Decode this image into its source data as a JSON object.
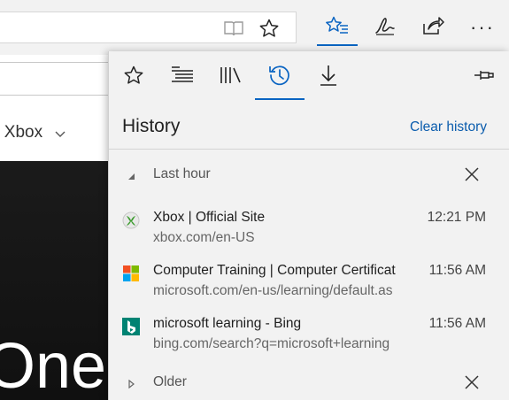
{
  "colors": {
    "accent": "#0a64c2",
    "link": "#0a5cad",
    "panel_bg": "#f2f2f2"
  },
  "toolbar": {
    "icons": [
      "reading-view-icon",
      "favorite-star-icon",
      "hub-favorites-icon",
      "web-note-icon",
      "share-icon",
      "more-icon"
    ],
    "more_label": "···"
  },
  "webpage": {
    "nav_label": "y Xbox",
    "hero_text": "One"
  },
  "hub": {
    "tabs": [
      {
        "name": "favorites",
        "icon": "star-icon"
      },
      {
        "name": "reading-list",
        "icon": "reading-list-icon"
      },
      {
        "name": "books",
        "icon": "books-icon"
      },
      {
        "name": "history",
        "icon": "history-icon",
        "active": true
      },
      {
        "name": "downloads",
        "icon": "download-icon"
      }
    ],
    "pin_icon": "pin-icon",
    "title": "History",
    "clear_label": "Clear history",
    "groups": [
      {
        "label": "Last hour",
        "expanded": true,
        "items": [
          {
            "title": "Xbox | Official Site",
            "url": "xbox.com/en-US",
            "time": "12:21 PM",
            "favicon": "xbox-icon"
          },
          {
            "title": "Computer Training | Computer Certificat",
            "url": "microsoft.com/en-us/learning/default.as",
            "time": "11:56 AM",
            "favicon": "microsoft-icon"
          },
          {
            "title": "microsoft learning - Bing",
            "url": "bing.com/search?q=microsoft+learning",
            "time": "11:56 AM",
            "favicon": "bing-icon"
          }
        ]
      },
      {
        "label": "Older",
        "expanded": false
      }
    ]
  }
}
